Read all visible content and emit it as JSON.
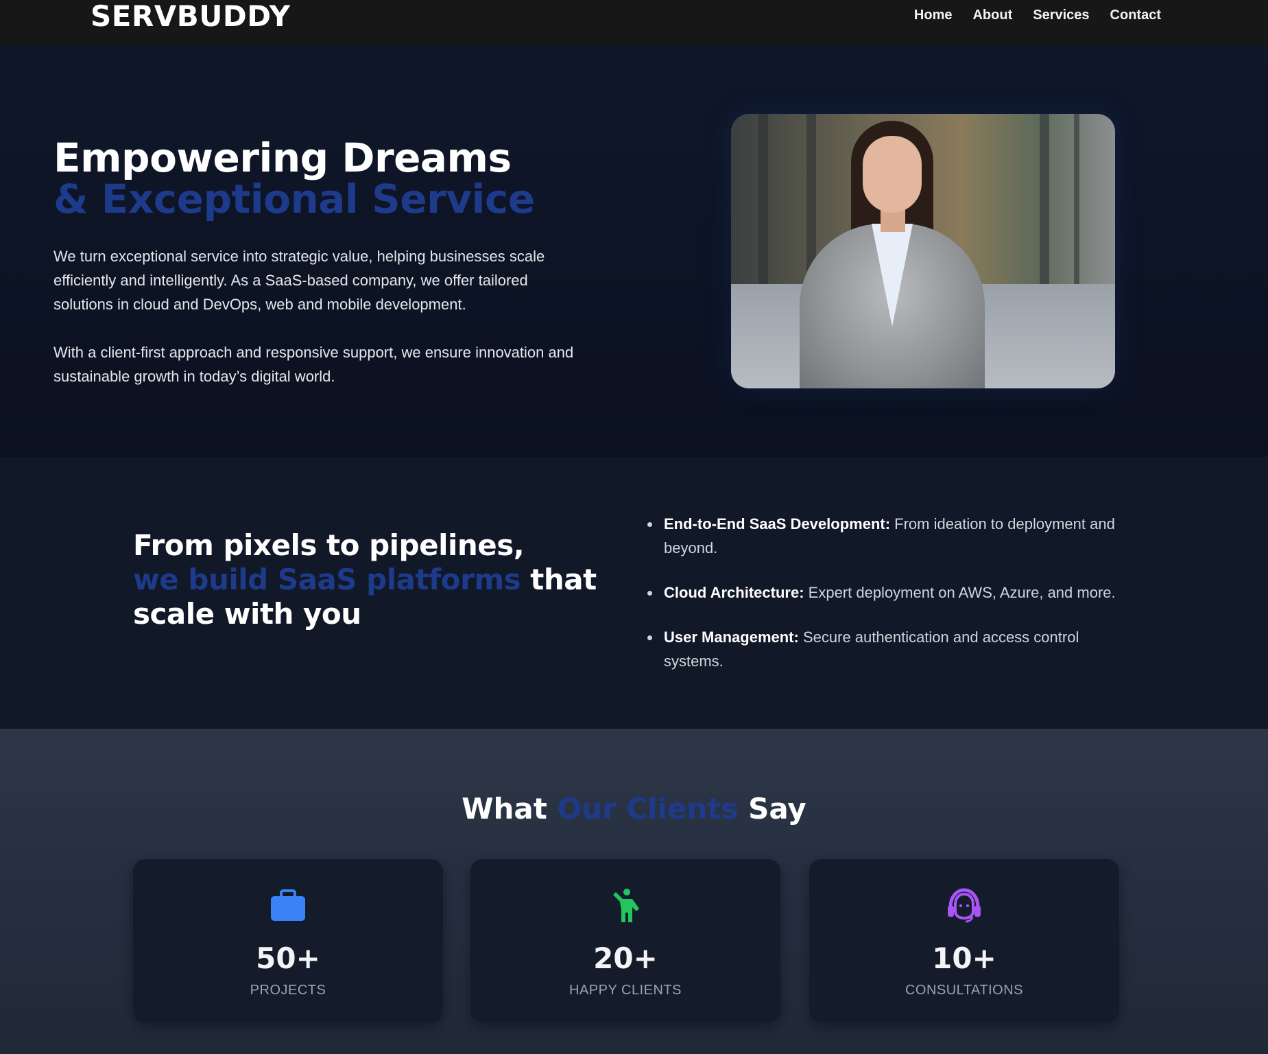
{
  "header": {
    "logo": "SERVBUDDY",
    "nav": [
      "Home",
      "About",
      "Services",
      "Contact"
    ]
  },
  "hero": {
    "title_line1": "Empowering Dreams",
    "title_line2": "& Exceptional Service",
    "paragraph1": "We turn exceptional service into strategic value, helping businesses scale efficiently and intelligently. As a SaaS-based company, we offer tailored solutions in cloud and DevOps, web and mobile development.",
    "paragraph2": "With a client-first approach and responsive support, we ensure innovation and sustainable growth in today’s digital world.",
    "image_icon": "businesswoman-photo"
  },
  "pipelines": {
    "title_part1": "From pixels to pipelines,",
    "title_accent": "we build SaaS platforms",
    "title_part2": "that",
    "title_part3": "scale with you",
    "features": [
      {
        "label": "End-to-End SaaS Development:",
        "text": "From ideation to deployment and beyond."
      },
      {
        "label": "Cloud Architecture:",
        "text": "Expert deployment on AWS, Azure, and more."
      },
      {
        "label": "User Management:",
        "text": "Secure authentication and access control systems."
      }
    ]
  },
  "clients": {
    "title_part1": "What",
    "title_accent": "Our Clients",
    "title_part2": "Say",
    "stats": [
      {
        "value": "50+",
        "label": "PROJECTS",
        "icon": "briefcase-icon",
        "color": "#3b82f6"
      },
      {
        "value": "20+",
        "label": "HAPPY CLIENTS",
        "icon": "person-waving-icon",
        "color": "#22c55e"
      },
      {
        "value": "10+",
        "label": "CONSULTATIONS",
        "icon": "headset-icon",
        "color": "#a855f7"
      }
    ]
  },
  "colors": {
    "accent": "#1e3a8a",
    "header_bg": "#171717",
    "page_bg": "#0b1120"
  }
}
